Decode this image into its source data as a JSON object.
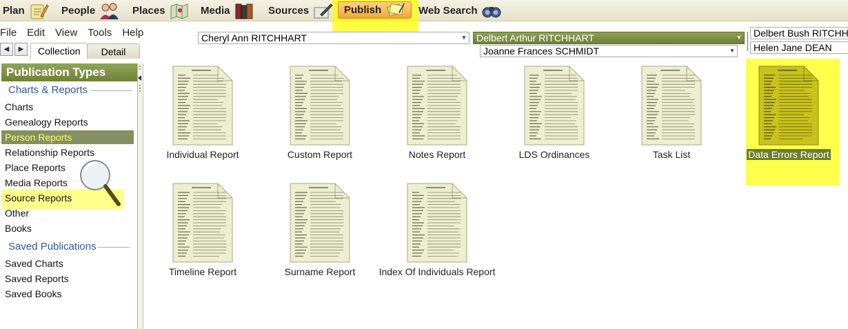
{
  "modules": [
    {
      "label": "Plan",
      "icon": "plan-notepad-icon"
    },
    {
      "label": "People",
      "icon": "people-couple-icon"
    },
    {
      "label": "Places",
      "icon": "places-map-icon"
    },
    {
      "label": "Media",
      "icon": "media-books-icon"
    },
    {
      "label": "Sources",
      "icon": "sources-pen-icon"
    },
    {
      "label": "Publish",
      "icon": "publish-documents-icon"
    },
    {
      "label": "Web Search",
      "icon": "binoculars-icon"
    }
  ],
  "menu": [
    "File",
    "Edit",
    "View",
    "Tools",
    "Help"
  ],
  "people": {
    "root": "Cheryl Ann RITCHHART",
    "father": "Delbert Arthur RITCHHART",
    "mother": "Joanne Frances SCHMIDT",
    "paternal_grandfather": "Delbert Bush RITCHHA",
    "paternal_grandmother": "Helen Jane DEAN"
  },
  "subtabs": [
    "Collection",
    "Detail"
  ],
  "sidebar": {
    "header": "Publication Types",
    "sections": [
      {
        "title": "Charts & Reports",
        "items": [
          "Charts",
          "Genealogy Reports",
          "Person Reports",
          "Relationship Reports",
          "Place Reports",
          "Media Reports",
          "Source Reports",
          "Other",
          "Books"
        ]
      },
      {
        "title": "Saved Publications",
        "items": [
          "Saved Charts",
          "Saved Reports",
          "Saved Books"
        ]
      }
    ],
    "selected": "Person Reports"
  },
  "reports": [
    {
      "label": "Individual Report",
      "thumb": "report-document-icon"
    },
    {
      "label": "Custom Report",
      "thumb": "report-document-icon"
    },
    {
      "label": "Notes Report",
      "thumb": "report-document-icon"
    },
    {
      "label": "LDS Ordinances",
      "thumb": "report-document-icon"
    },
    {
      "label": "Task List",
      "thumb": "report-document-icon"
    },
    {
      "label": "Data Errors Report",
      "thumb": "report-document-icon"
    },
    {
      "label": "Timeline Report",
      "thumb": "report-document-icon"
    },
    {
      "label": "Surname Report",
      "thumb": "report-document-icon"
    },
    {
      "label": "Index Of Individuals Report",
      "thumb": "report-document-icon"
    }
  ],
  "selected_report": "Data Errors Report",
  "colors": {
    "accent_green": "#6e7d45",
    "highlight_yellow": "#ffff00",
    "publish_orange": "#f3a53a",
    "section_blue": "#2d55a5"
  }
}
